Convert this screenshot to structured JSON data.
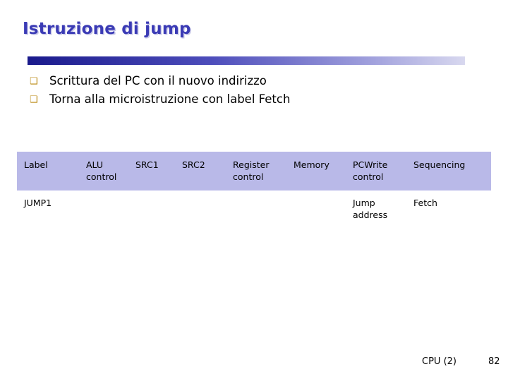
{
  "slide": {
    "title": "Istruzione di jump",
    "bullets": [
      {
        "marker": "❑",
        "text": "Scrittura del PC con il nuovo indirizzo"
      },
      {
        "marker": "❑",
        "text": "Torna alla microistruzione con label Fetch"
      }
    ],
    "table": {
      "headers": {
        "label": "Label",
        "alu_control": "ALU\ncontrol",
        "src1": "SRC1",
        "src2": "SRC2",
        "register_control": "Register\ncontrol",
        "memory": "Memory",
        "pcwrite_control": "PCWrite\ncontrol",
        "sequencing": "Sequencing"
      },
      "rows": [
        {
          "label": "JUMP1",
          "alu_control": "",
          "src1": "",
          "src2": "",
          "register_control": "",
          "memory": "",
          "pcwrite_control": "Jump\naddress",
          "sequencing": "Fetch"
        }
      ]
    },
    "footer": {
      "left": "CPU (2)",
      "page": "82"
    },
    "colors": {
      "title": "#3b3bb5",
      "header_band": "#b9b9e8",
      "bullet_marker": "#b8860b"
    }
  }
}
